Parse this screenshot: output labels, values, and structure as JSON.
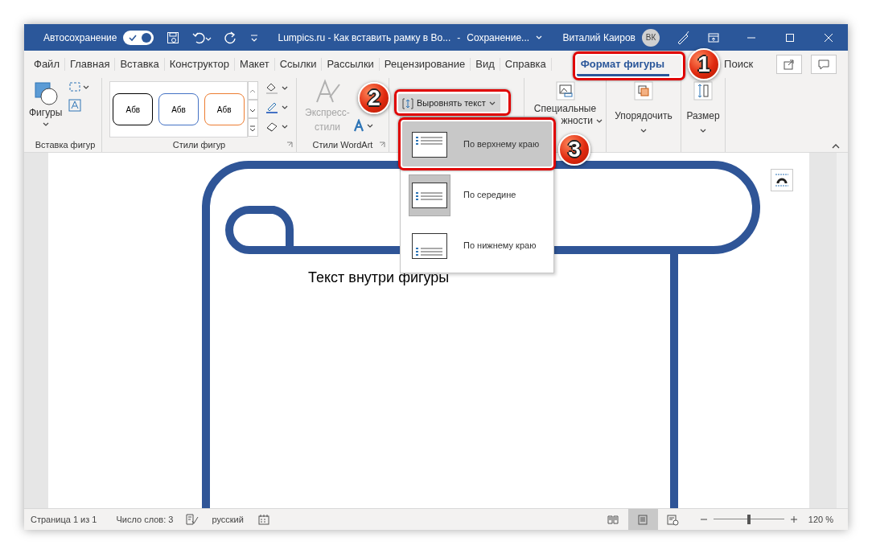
{
  "window": {
    "autosave_label": "Автосохранение",
    "autosave_on": true,
    "title": "Lumpics.ru - Как вставить рамку в Во...",
    "separator": "-",
    "save_state": "Сохранение...",
    "user": "Виталий Каиров",
    "avatar": "ВК"
  },
  "tabs": [
    {
      "label": "Файл",
      "selected": false
    },
    {
      "label": "Главная",
      "selected": false
    },
    {
      "label": "Вставка",
      "selected": false
    },
    {
      "label": "Конструктор",
      "selected": false
    },
    {
      "label": "Макет",
      "selected": false
    },
    {
      "label": "Ссылки",
      "selected": false
    },
    {
      "label": "Рассылки",
      "selected": false
    },
    {
      "label": "Рецензирование",
      "selected": false
    },
    {
      "label": "Вид",
      "selected": false
    },
    {
      "label": "Справка",
      "selected": false
    },
    {
      "label": "Формат фигуры",
      "selected": true
    }
  ],
  "search": {
    "label": "Поиск"
  },
  "ribbon": {
    "insert_shapes": {
      "button": "Фигуры",
      "group_label": "Вставка фигур"
    },
    "shape_styles": {
      "samples": [
        {
          "text": "Абв",
          "color": "#000000"
        },
        {
          "text": "Абв",
          "color": "#4472c4"
        },
        {
          "text": "Абв",
          "color": "#ed7d31"
        }
      ],
      "group_label": "Стили фигур"
    },
    "wordart": {
      "button_lines": [
        "Экспресс-",
        "стили"
      ],
      "disabled": true,
      "group_label": "Стили WordArt"
    },
    "text": {
      "align_button": "Выровнять текст"
    },
    "accessibility": {
      "button_lines": [
        "Специальные",
        "жности"
      ]
    },
    "arrange": {
      "button": "Упорядочить"
    },
    "size": {
      "button": "Размер"
    }
  },
  "align_menu": {
    "items": [
      {
        "label": "По верхнему краю",
        "kind": "top",
        "highlighted": true,
        "selected": false
      },
      {
        "label": "По середине",
        "kind": "middle",
        "highlighted": false,
        "selected": true
      },
      {
        "label": "По нижнему краю",
        "kind": "bottom",
        "highlighted": false,
        "selected": false
      }
    ]
  },
  "document": {
    "text": "Текст внутри фигуры"
  },
  "callouts": [
    {
      "number": "1"
    },
    {
      "number": "2"
    },
    {
      "number": "3"
    }
  ],
  "status_bar": {
    "page": "Страница 1 из 1",
    "words": "Число слов: 3",
    "language": "русский",
    "views": [
      {
        "kind": "read",
        "selected": false
      },
      {
        "kind": "print",
        "selected": true
      },
      {
        "kind": "web",
        "selected": false
      }
    ],
    "zoom": {
      "level": 0.5,
      "label": "120 %"
    }
  }
}
